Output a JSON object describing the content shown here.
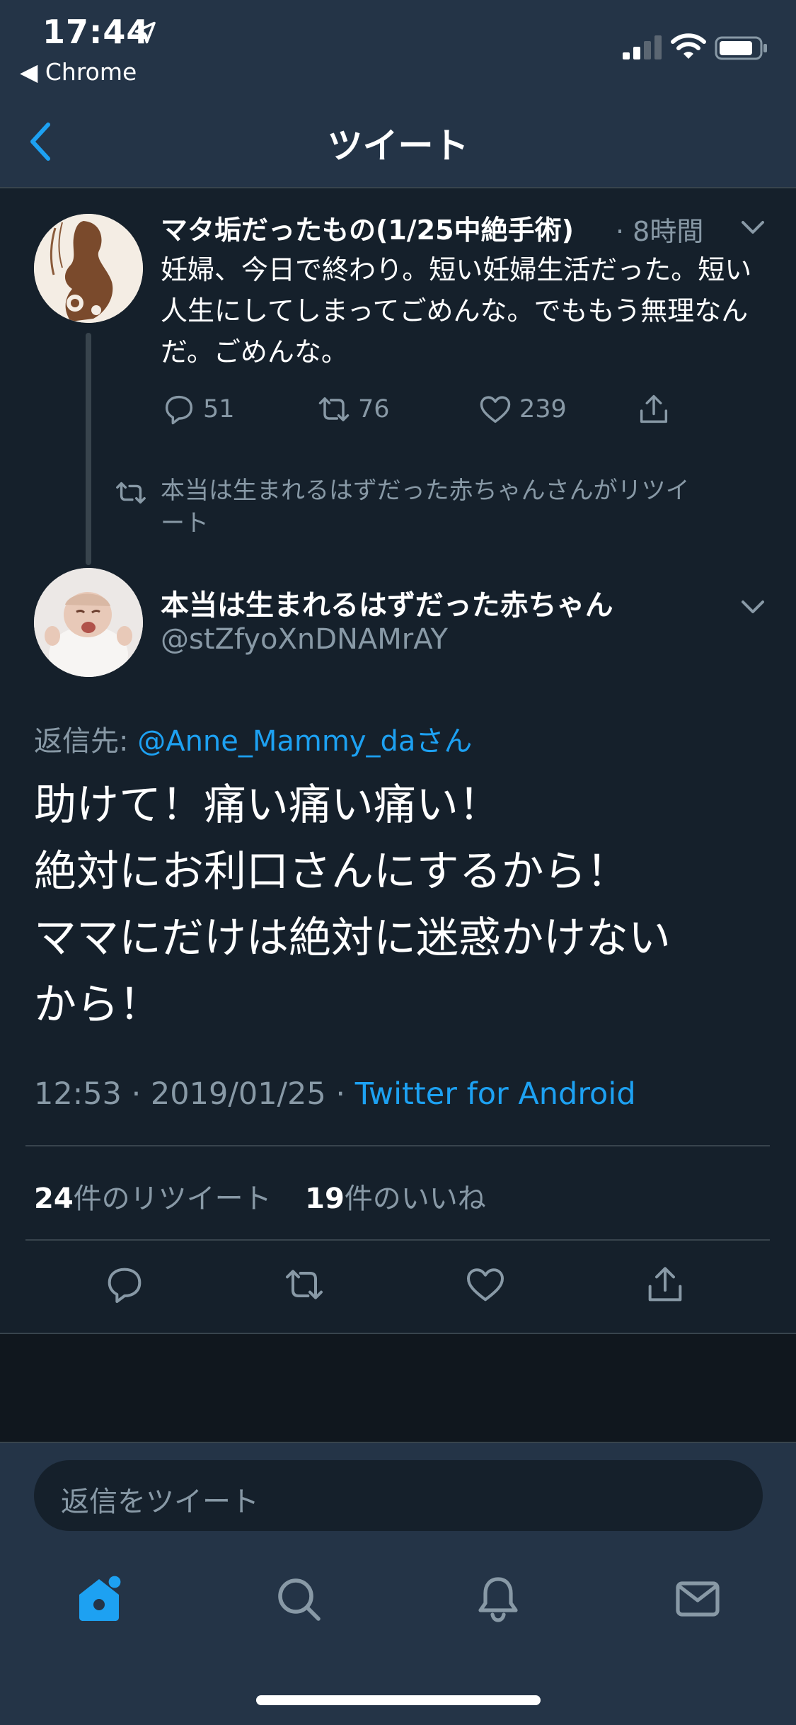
{
  "status_bar": {
    "time": "17:44",
    "back_app": "◀ Chrome",
    "icons": [
      "location-arrow-icon",
      "signal-icon",
      "wifi-icon",
      "battery-icon"
    ]
  },
  "nav": {
    "title": "ツイート",
    "back_icon": "chevron-left-icon"
  },
  "parent_tweet": {
    "display_name": "マタ垢だったもの(1/25中絶手術)",
    "time": "· 8時間",
    "body": "妊婦、今日で終わり。短い妊婦生活だった。短い人生にしてしまってごめんな。でももう無理なんだ。ごめんな。",
    "reply_count": "51",
    "retweet_count": "76",
    "like_count": "239"
  },
  "retweet_notice": "本当は生まれるはずだった赤ちゃんさんがリツイート",
  "main_tweet": {
    "display_name": "本当は生まれるはずだった赤ちゃん",
    "handle": "@stZfyoXnDNAMrAY",
    "reply_to_label": "返信先: ",
    "reply_to_mention": "@Anne_Mammy_daさん",
    "body_lines": [
      "助けて！痛い痛い痛い！",
      "絶対にお利口さんにするから！",
      "ママにだけは絶対に迷惑かけない",
      "から！"
    ],
    "timestamp": "12:53 · 2019/01/25 · ",
    "source": "Twitter for Android",
    "retweets_num": "24",
    "retweets_label": "件のリツイート",
    "likes_num": "19",
    "likes_label": "件のいいね"
  },
  "composer": {
    "placeholder": "返信をツイート"
  },
  "tab_bar": [
    "home-icon",
    "search-icon",
    "notifications-icon",
    "messages-icon"
  ],
  "colors": {
    "background": "#15202b",
    "bars": "#243447",
    "accent": "#1da1f2",
    "secondary_text": "#8899a6",
    "border": "#38444d"
  }
}
